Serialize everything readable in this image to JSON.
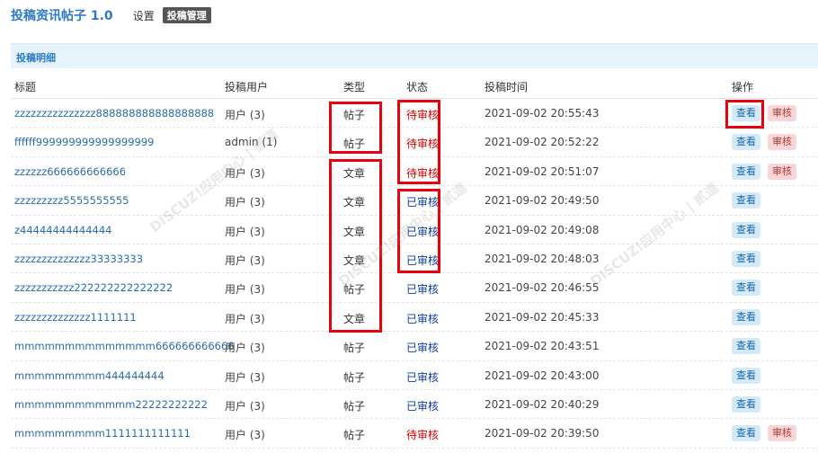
{
  "header": {
    "app_title": "投稿资讯帖子 1.0",
    "nav_settings": "设置",
    "nav_manage": "投稿管理"
  },
  "panel": {
    "title": "投稿明细"
  },
  "columns": {
    "title": "标题",
    "user": "投稿用户",
    "type": "类型",
    "status": "状态",
    "time": "投稿时间",
    "ops": "操作"
  },
  "rows": [
    {
      "title": "zzzzzzzzzzzzzzz888888888888888888",
      "user": "用户 (3)",
      "type": "帖子",
      "status": "待审核",
      "time": "2021-09-02 20:55:43",
      "view": "查看",
      "review": "审核"
    },
    {
      "title": "ffffff999999999999999999",
      "user": "admin (1)",
      "type": "帖子",
      "status": "待审核",
      "time": "2021-09-02 20:52:22",
      "view": "查看",
      "review": "审核"
    },
    {
      "title": "zzzzzz666666666666",
      "user": "用户 (3)",
      "type": "文章",
      "status": "待审核",
      "time": "2021-09-02 20:51:07",
      "view": "查看",
      "review": "审核"
    },
    {
      "title": "zzzzzzzzz5555555555",
      "user": "用户 (3)",
      "type": "文章",
      "status": "已审核",
      "time": "2021-09-02 20:49:50",
      "view": "查看",
      "review": ""
    },
    {
      "title": "z44444444444444",
      "user": "用户 (3)",
      "type": "文章",
      "status": "已审核",
      "time": "2021-09-02 20:49:08",
      "view": "查看",
      "review": ""
    },
    {
      "title": "zzzzzzzzzzzzzz33333333",
      "user": "用户 (3)",
      "type": "文章",
      "status": "已审核",
      "time": "2021-09-02 20:48:03",
      "view": "查看",
      "review": ""
    },
    {
      "title": "zzzzzzzzzzz222222222222222",
      "user": "用户 (3)",
      "type": "帖子",
      "status": "已审核",
      "time": "2021-09-02 20:46:55",
      "view": "查看",
      "review": ""
    },
    {
      "title": "zzzzzzzzzzzzzz1111111",
      "user": "用户 (3)",
      "type": "文章",
      "status": "已审核",
      "time": "2021-09-02 20:45:33",
      "view": "查看",
      "review": ""
    },
    {
      "title": "mmmmmmmmmmmmmm666666666666",
      "user": "用户 (3)",
      "type": "帖子",
      "status": "已审核",
      "time": "2021-09-02 20:43:51",
      "view": "查看",
      "review": ""
    },
    {
      "title": "mmmmmmmmm444444444",
      "user": "用户 (3)",
      "type": "帖子",
      "status": "已审核",
      "time": "2021-09-02 20:43:00",
      "view": "查看",
      "review": ""
    },
    {
      "title": "mmmmmmmmmmmm22222222222",
      "user": "用户 (3)",
      "type": "帖子",
      "status": "已审核",
      "time": "2021-09-02 20:40:29",
      "view": "查看",
      "review": ""
    },
    {
      "title": "mmmmmmmmm1111111111111",
      "user": "用户 (3)",
      "type": "帖子",
      "status": "待审核",
      "time": "2021-09-02 20:39:50",
      "view": "查看",
      "review": "审核"
    }
  ],
  "watermark": {
    "text_cn": "DISCUZ!应用中心 | 贰道",
    "text_url": "addon.dismall.com"
  },
  "colors": {
    "accent": "#2b7acb",
    "pending": "#d40000",
    "approved": "#0b3c9e",
    "highlight": "#e8000b"
  }
}
